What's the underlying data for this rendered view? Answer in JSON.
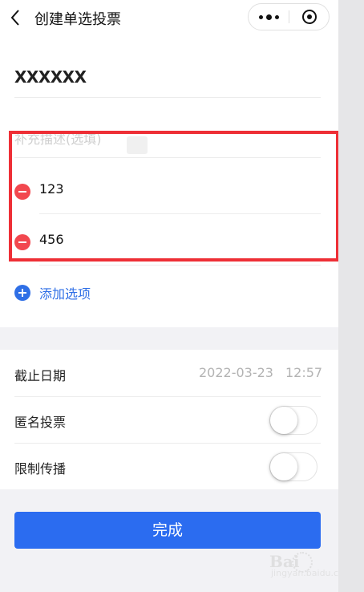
{
  "header": {
    "title": "创建单选投票",
    "back_icon": "chevron-left-icon",
    "menu_icon": "more-dots-icon",
    "close_icon": "record-target-icon"
  },
  "vote": {
    "title": "XXXXXX",
    "description_placeholder": "补充描述(选填)",
    "options": [
      {
        "label": "123",
        "remove_icon": "minus-circle-icon"
      },
      {
        "label": "456",
        "remove_icon": "minus-circle-icon"
      }
    ],
    "add_option_label": "添加选项",
    "add_option_icon": "plus-circle-icon"
  },
  "settings": {
    "deadline_label": "截止日期",
    "deadline_date": "2022-03-23",
    "deadline_time": "12:57",
    "anonymous_label": "匿名投票",
    "anonymous_on": false,
    "restrict_label": "限制传播",
    "restrict_on": false
  },
  "footer": {
    "done_label": "完成"
  },
  "watermark": {
    "text": "Bai",
    "sub": "jingyan.baidu.com"
  },
  "colors": {
    "primary_blue": "#2b6cf0",
    "remove_red": "#f2484f",
    "highlight_red": "#ee2f36",
    "placeholder_gray": "#cfcfcf"
  }
}
